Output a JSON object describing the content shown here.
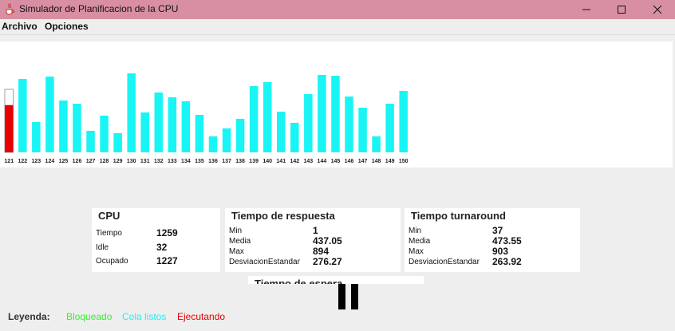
{
  "window": {
    "title": "Simulador de Planificacion de la CPU",
    "icons": [
      "java-cup-icon",
      "minimize-icon",
      "maximize-icon",
      "close-icon"
    ]
  },
  "menu": {
    "items": [
      "Archivo",
      "Opciones"
    ]
  },
  "chart_data": {
    "type": "bar",
    "categories": [
      "121",
      "122",
      "123",
      "124",
      "125",
      "126",
      "127",
      "128",
      "129",
      "130",
      "131",
      "132",
      "133",
      "134",
      "135",
      "136",
      "137",
      "138",
      "139",
      "140",
      "141",
      "142",
      "143",
      "144",
      "145",
      "146",
      "147",
      "148",
      "149",
      "150"
    ],
    "values": [
      79,
      92,
      38,
      95,
      65,
      61,
      27,
      46,
      24,
      99,
      50,
      75,
      69,
      64,
      47,
      20,
      30,
      42,
      83,
      88,
      51,
      37,
      73,
      97,
      96,
      70,
      56,
      20,
      61,
      77
    ],
    "highlight": {
      "index": 0,
      "fill": 0.75,
      "color": "#e80000",
      "empty_color": "#ffffff"
    },
    "bar_color": "#19f5f5",
    "ylim": [
      0,
      100
    ],
    "title": "",
    "xlabel": "",
    "ylabel": "",
    "grid": false
  },
  "stats": {
    "cpu": {
      "title": "CPU",
      "rows": [
        {
          "label": "Tiempo",
          "value": "1259"
        },
        {
          "label": "Idle",
          "value": "32"
        },
        {
          "label": "Ocupado",
          "value": "1227"
        }
      ]
    },
    "respuesta": {
      "title": "Tiempo de respuesta",
      "rows": [
        {
          "label": "Min",
          "value": "1"
        },
        {
          "label": "Media",
          "value": "437.05"
        },
        {
          "label": "Max",
          "value": "894"
        },
        {
          "label": "DesviacionEstandar",
          "value": "276.27"
        }
      ]
    },
    "turnaround": {
      "title": "Tiempo turnaround",
      "rows": [
        {
          "label": "Min",
          "value": "37"
        },
        {
          "label": "Media",
          "value": "473.55"
        },
        {
          "label": "Max",
          "value": "903"
        },
        {
          "label": "DesviacionEstandar",
          "value": "263.92"
        }
      ]
    },
    "espera": {
      "title": "Tiempo de espera"
    }
  },
  "controls": {
    "pause_icon": "pause-icon"
  },
  "legend": {
    "label": "Leyenda:",
    "items": [
      {
        "text": "Bloqueado",
        "color": "#2cf52c"
      },
      {
        "text": "Cola listos",
        "color": "#19f5f5"
      },
      {
        "text": "Ejecutando",
        "color": "#e80000"
      }
    ]
  }
}
